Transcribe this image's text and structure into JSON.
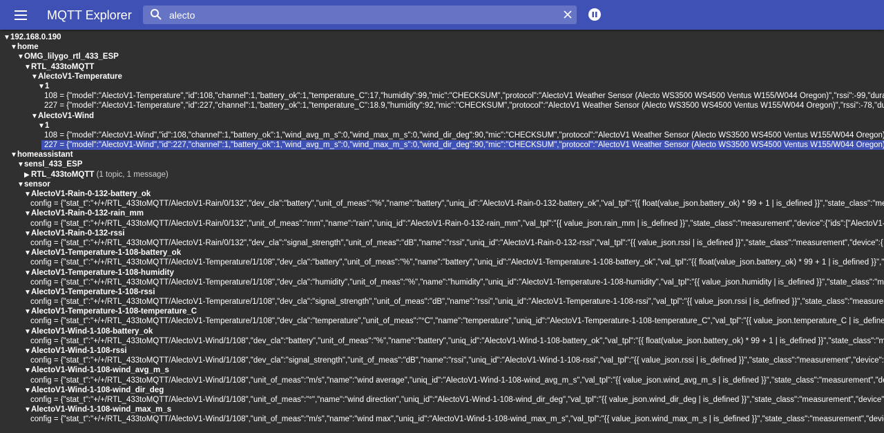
{
  "app": {
    "title": "MQTT Explorer",
    "search_value": "alecto",
    "icons": {
      "menu": "menu-icon",
      "search": "search-icon",
      "clear": "close-icon",
      "pause": "pause-icon"
    }
  },
  "colors": {
    "appbar": "#3f51b5",
    "background": "#303030",
    "search": "#6574c4",
    "selected": "#3f51b5"
  },
  "tree": {
    "broker": "192.168.0.190",
    "home": "home",
    "omg": "OMG_lilygo_rtl_433_ESP",
    "rtl": "RTL_433toMQTT",
    "temp_node": "AlectoV1-Temperature",
    "temp_channel": "1",
    "temp_msgs": [
      "108 = {\"model\":\"AlectoV1-Temperature\",\"id\":108,\"channel\":1,\"battery_ok\":1,\"temperature_C\":17,\"humidity\":99,\"mic\":\"CHECKSUM\",\"protocol\":\"AlectoV1 Weather Sensor (Alecto WS3500 WS4500 Ventus W155/W044 Oregon)\",\"rssi\":-99,\"durat",
      "227 = {\"model\":\"AlectoV1-Temperature\",\"id\":227,\"channel\":1,\"battery_ok\":1,\"temperature_C\":18.9,\"humidity\":92,\"mic\":\"CHECKSUM\",\"protocol\":\"AlectoV1 Weather Sensor (Alecto WS3500 WS4500 Ventus W155/W044 Oregon)\",\"rssi\":-78,\"dur"
    ],
    "wind_node": "AlectoV1-Wind",
    "wind_channel": "1",
    "wind_msgs": [
      "108 = {\"model\":\"AlectoV1-Wind\",\"id\":108,\"channel\":1,\"battery_ok\":1,\"wind_avg_m_s\":0,\"wind_max_m_s\":0,\"wind_dir_deg\":90,\"mic\":\"CHECKSUM\",\"protocol\":\"AlectoV1 Weather Sensor (Alecto WS3500 WS4500 Ventus W155/W044 Oregon)\",",
      "227 = {\"model\":\"AlectoV1-Wind\",\"id\":227,\"channel\":1,\"battery_ok\":1,\"wind_avg_m_s\":0,\"wind_max_m_s\":0,\"wind_dir_deg\":90,\"mic\":\"CHECKSUM\",\"protocol\":\"AlectoV1 Weather Sensor (Alecto WS3500 WS4500 Ventus W155/W044 Oregon)\","
    ],
    "homeassistant": "homeassistant",
    "sensl": "sensl_433_ESP",
    "collapsed": "RTL_433toMQTT",
    "collapsed_meta": "(1 topic, 1 message)",
    "sensor": "sensor",
    "configs": [
      {
        "name": "AlectoV1-Rain-0-132-battery_ok",
        "config": "config = {\"stat_t\":\"+/+/RTL_433toMQTT/AlectoV1-Rain/0/132\",\"dev_cla\":\"battery\",\"unit_of_meas\":\"%\",\"name\":\"battery\",\"uniq_id\":\"AlectoV1-Rain-0-132-battery_ok\",\"val_tpl\":\"{{ float(value_json.battery_ok) * 99 + 1 | is_defined }}\",\"state_class\":\"me"
      },
      {
        "name": "AlectoV1-Rain-0-132-rain_mm",
        "config": "config = {\"stat_t\":\"+/+/RTL_433toMQTT/AlectoV1-Rain/0/132\",\"unit_of_meas\":\"mm\",\"name\":\"rain\",\"uniq_id\":\"AlectoV1-Rain-0-132-rain_mm\",\"val_tpl\":\"{{ value_json.rain_mm | is_defined }}\",\"state_class\":\"measurement\",\"device\":{\"ids\":[\"AlectoV1-"
      },
      {
        "name": "AlectoV1-Rain-0-132-rssi",
        "config": "config = {\"stat_t\":\"+/+/RTL_433toMQTT/AlectoV1-Rain/0/132\",\"dev_cla\":\"signal_strength\",\"unit_of_meas\":\"dB\",\"name\":\"rssi\",\"uniq_id\":\"AlectoV1-Rain-0-132-rssi\",\"val_tpl\":\"{{ value_json.rssi | is_defined }}\",\"state_class\":\"measurement\",\"device\":{"
      },
      {
        "name": "AlectoV1-Temperature-1-108-battery_ok",
        "config": "config = {\"stat_t\":\"+/+/RTL_433toMQTT/AlectoV1-Temperature/1/108\",\"dev_cla\":\"battery\",\"unit_of_meas\":\"%\",\"name\":\"battery\",\"uniq_id\":\"AlectoV1-Temperature-1-108-battery_ok\",\"val_tpl\":\"{{ float(value_json.battery_ok) * 99 + 1 | is_defined }}\",\""
      },
      {
        "name": "AlectoV1-Temperature-1-108-humidity",
        "config": "config = {\"stat_t\":\"+/+/RTL_433toMQTT/AlectoV1-Temperature/1/108\",\"dev_cla\":\"humidity\",\"unit_of_meas\":\"%\",\"name\":\"humidity\",\"uniq_id\":\"AlectoV1-Temperature-1-108-humidity\",\"val_tpl\":\"{{ value_json.humidity | is_defined }}\",\"state_class\":\"me"
      },
      {
        "name": "AlectoV1-Temperature-1-108-rssi",
        "config": "config = {\"stat_t\":\"+/+/RTL_433toMQTT/AlectoV1-Temperature/1/108\",\"dev_cla\":\"signal_strength\",\"unit_of_meas\":\"dB\",\"name\":\"rssi\",\"uniq_id\":\"AlectoV1-Temperature-1-108-rssi\",\"val_tpl\":\"{{ value_json.rssi | is_defined }}\",\"state_class\":\"measurer"
      },
      {
        "name": "AlectoV1-Temperature-1-108-temperature_C",
        "config": "config = {\"stat_t\":\"+/+/RTL_433toMQTT/AlectoV1-Temperature/1/108\",\"dev_cla\":\"temperature\",\"unit_of_meas\":\"°C\",\"name\":\"temperature\",\"uniq_id\":\"AlectoV1-Temperature-1-108-temperature_C\",\"val_tpl\":\"{{ value_json.temperature_C | is_define"
      },
      {
        "name": "AlectoV1-Wind-1-108-battery_ok",
        "config": "config = {\"stat_t\":\"+/+/RTL_433toMQTT/AlectoV1-Wind/1/108\",\"dev_cla\":\"battery\",\"unit_of_meas\":\"%\",\"name\":\"battery\",\"uniq_id\":\"AlectoV1-Wind-1-108-battery_ok\",\"val_tpl\":\"{{ float(value_json.battery_ok) * 99 + 1 | is_defined }}\",\"state_class\":\"m"
      },
      {
        "name": "AlectoV1-Wind-1-108-rssi",
        "config": "config = {\"stat_t\":\"+/+/RTL_433toMQTT/AlectoV1-Wind/1/108\",\"dev_cla\":\"signal_strength\",\"unit_of_meas\":\"dB\",\"name\":\"rssi\",\"uniq_id\":\"AlectoV1-Wind-1-108-rssi\",\"val_tpl\":\"{{ value_json.rssi | is_defined }}\",\"state_class\":\"measurement\",\"device\":{"
      },
      {
        "name": "AlectoV1-Wind-1-108-wind_avg_m_s",
        "config": "config = {\"stat_t\":\"+/+/RTL_433toMQTT/AlectoV1-Wind/1/108\",\"unit_of_meas\":\"m/s\",\"name\":\"wind average\",\"uniq_id\":\"AlectoV1-Wind-1-108-wind_avg_m_s\",\"val_tpl\":\"{{ value_json.wind_avg_m_s | is_defined }}\",\"state_class\":\"measurement\",\"de"
      },
      {
        "name": "AlectoV1-Wind-1-108-wind_dir_deg",
        "config": "config = {\"stat_t\":\"+/+/RTL_433toMQTT/AlectoV1-Wind/1/108\",\"unit_of_meas\":\"°\",\"name\":\"wind direction\",\"uniq_id\":\"AlectoV1-Wind-1-108-wind_dir_deg\",\"val_tpl\":\"{{ value_json.wind_dir_deg | is_defined }}\",\"state_class\":\"measurement\",\"device\":"
      },
      {
        "name": "AlectoV1-Wind-1-108-wind_max_m_s",
        "config": "config = {\"stat_t\":\"+/+/RTL_433toMQTT/AlectoV1-Wind/1/108\",\"unit_of_meas\":\"m/s\",\"name\":\"wind max\",\"uniq_id\":\"AlectoV1-Wind-1-108-wind_max_m_s\",\"val_tpl\":\"{{ value_json.wind_max_m_s | is_defined }}\",\"state_class\":\"measurement\",\"devic"
      }
    ]
  }
}
